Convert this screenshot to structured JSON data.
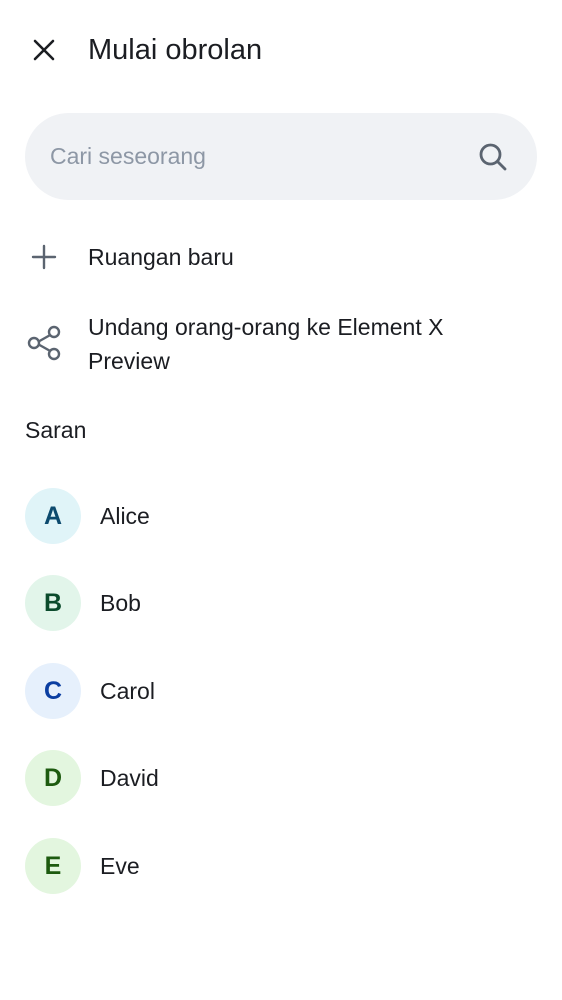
{
  "header": {
    "title": "Mulai obrolan"
  },
  "search": {
    "placeholder": "Cari seseorang",
    "value": ""
  },
  "actions": [
    {
      "label": "Ruangan baru",
      "icon": "plus-icon"
    },
    {
      "label": "Undang orang-orang ke Element X Preview",
      "icon": "share-icon"
    }
  ],
  "suggestions": {
    "title": "Saran",
    "items": [
      {
        "initial": "A",
        "name": "Alice",
        "avatar_bg": "#e0f4f8",
        "avatar_fg": "#0c4a6e"
      },
      {
        "initial": "B",
        "name": "Bob",
        "avatar_bg": "#e2f5ea",
        "avatar_fg": "#0b4b2c"
      },
      {
        "initial": "C",
        "name": "Carol",
        "avatar_bg": "#e6f0fc",
        "avatar_fg": "#0b3ea1"
      },
      {
        "initial": "D",
        "name": "David",
        "avatar_bg": "#e3f6df",
        "avatar_fg": "#1d5a0f"
      },
      {
        "initial": "E",
        "name": "Eve",
        "avatar_bg": "#e3f6df",
        "avatar_fg": "#1d5a0f"
      }
    ]
  },
  "colors": {
    "search_bg": "#f0f2f5",
    "placeholder": "#8d97a5",
    "text_primary": "#1b1d22",
    "icon": "#5b6470"
  }
}
